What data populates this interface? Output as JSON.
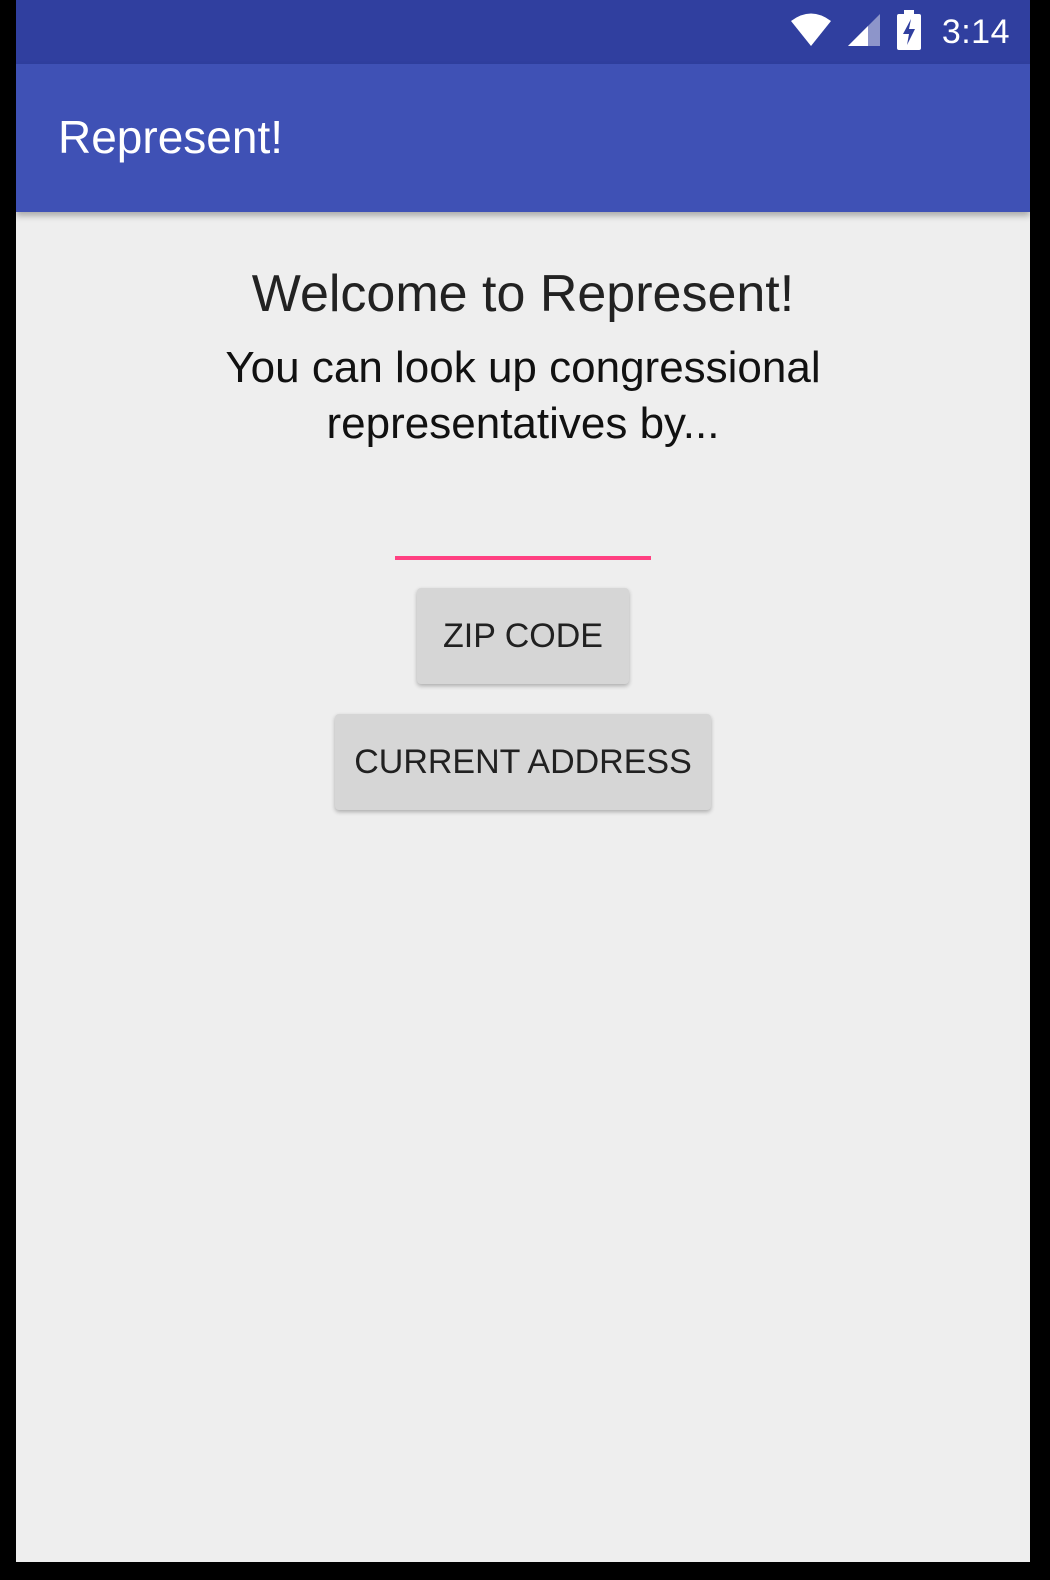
{
  "status_bar": {
    "time": "3:14",
    "icons": [
      "wifi-icon",
      "cell-signal-icon",
      "battery-charging-icon"
    ]
  },
  "app_bar": {
    "title": "Represent!"
  },
  "main": {
    "welcome": "Welcome to Represent!",
    "subtitle": "You can look up congressional representatives by...",
    "zip_input": {
      "value": "",
      "placeholder": ""
    },
    "zip_button_label": "ZIP CODE",
    "address_button_label": "CURRENT ADDRESS"
  },
  "colors": {
    "status_bar": "#303f9f",
    "app_bar": "#3f51b5",
    "accent": "#ff4081",
    "background": "#eeeeee",
    "button": "#d6d6d6"
  }
}
